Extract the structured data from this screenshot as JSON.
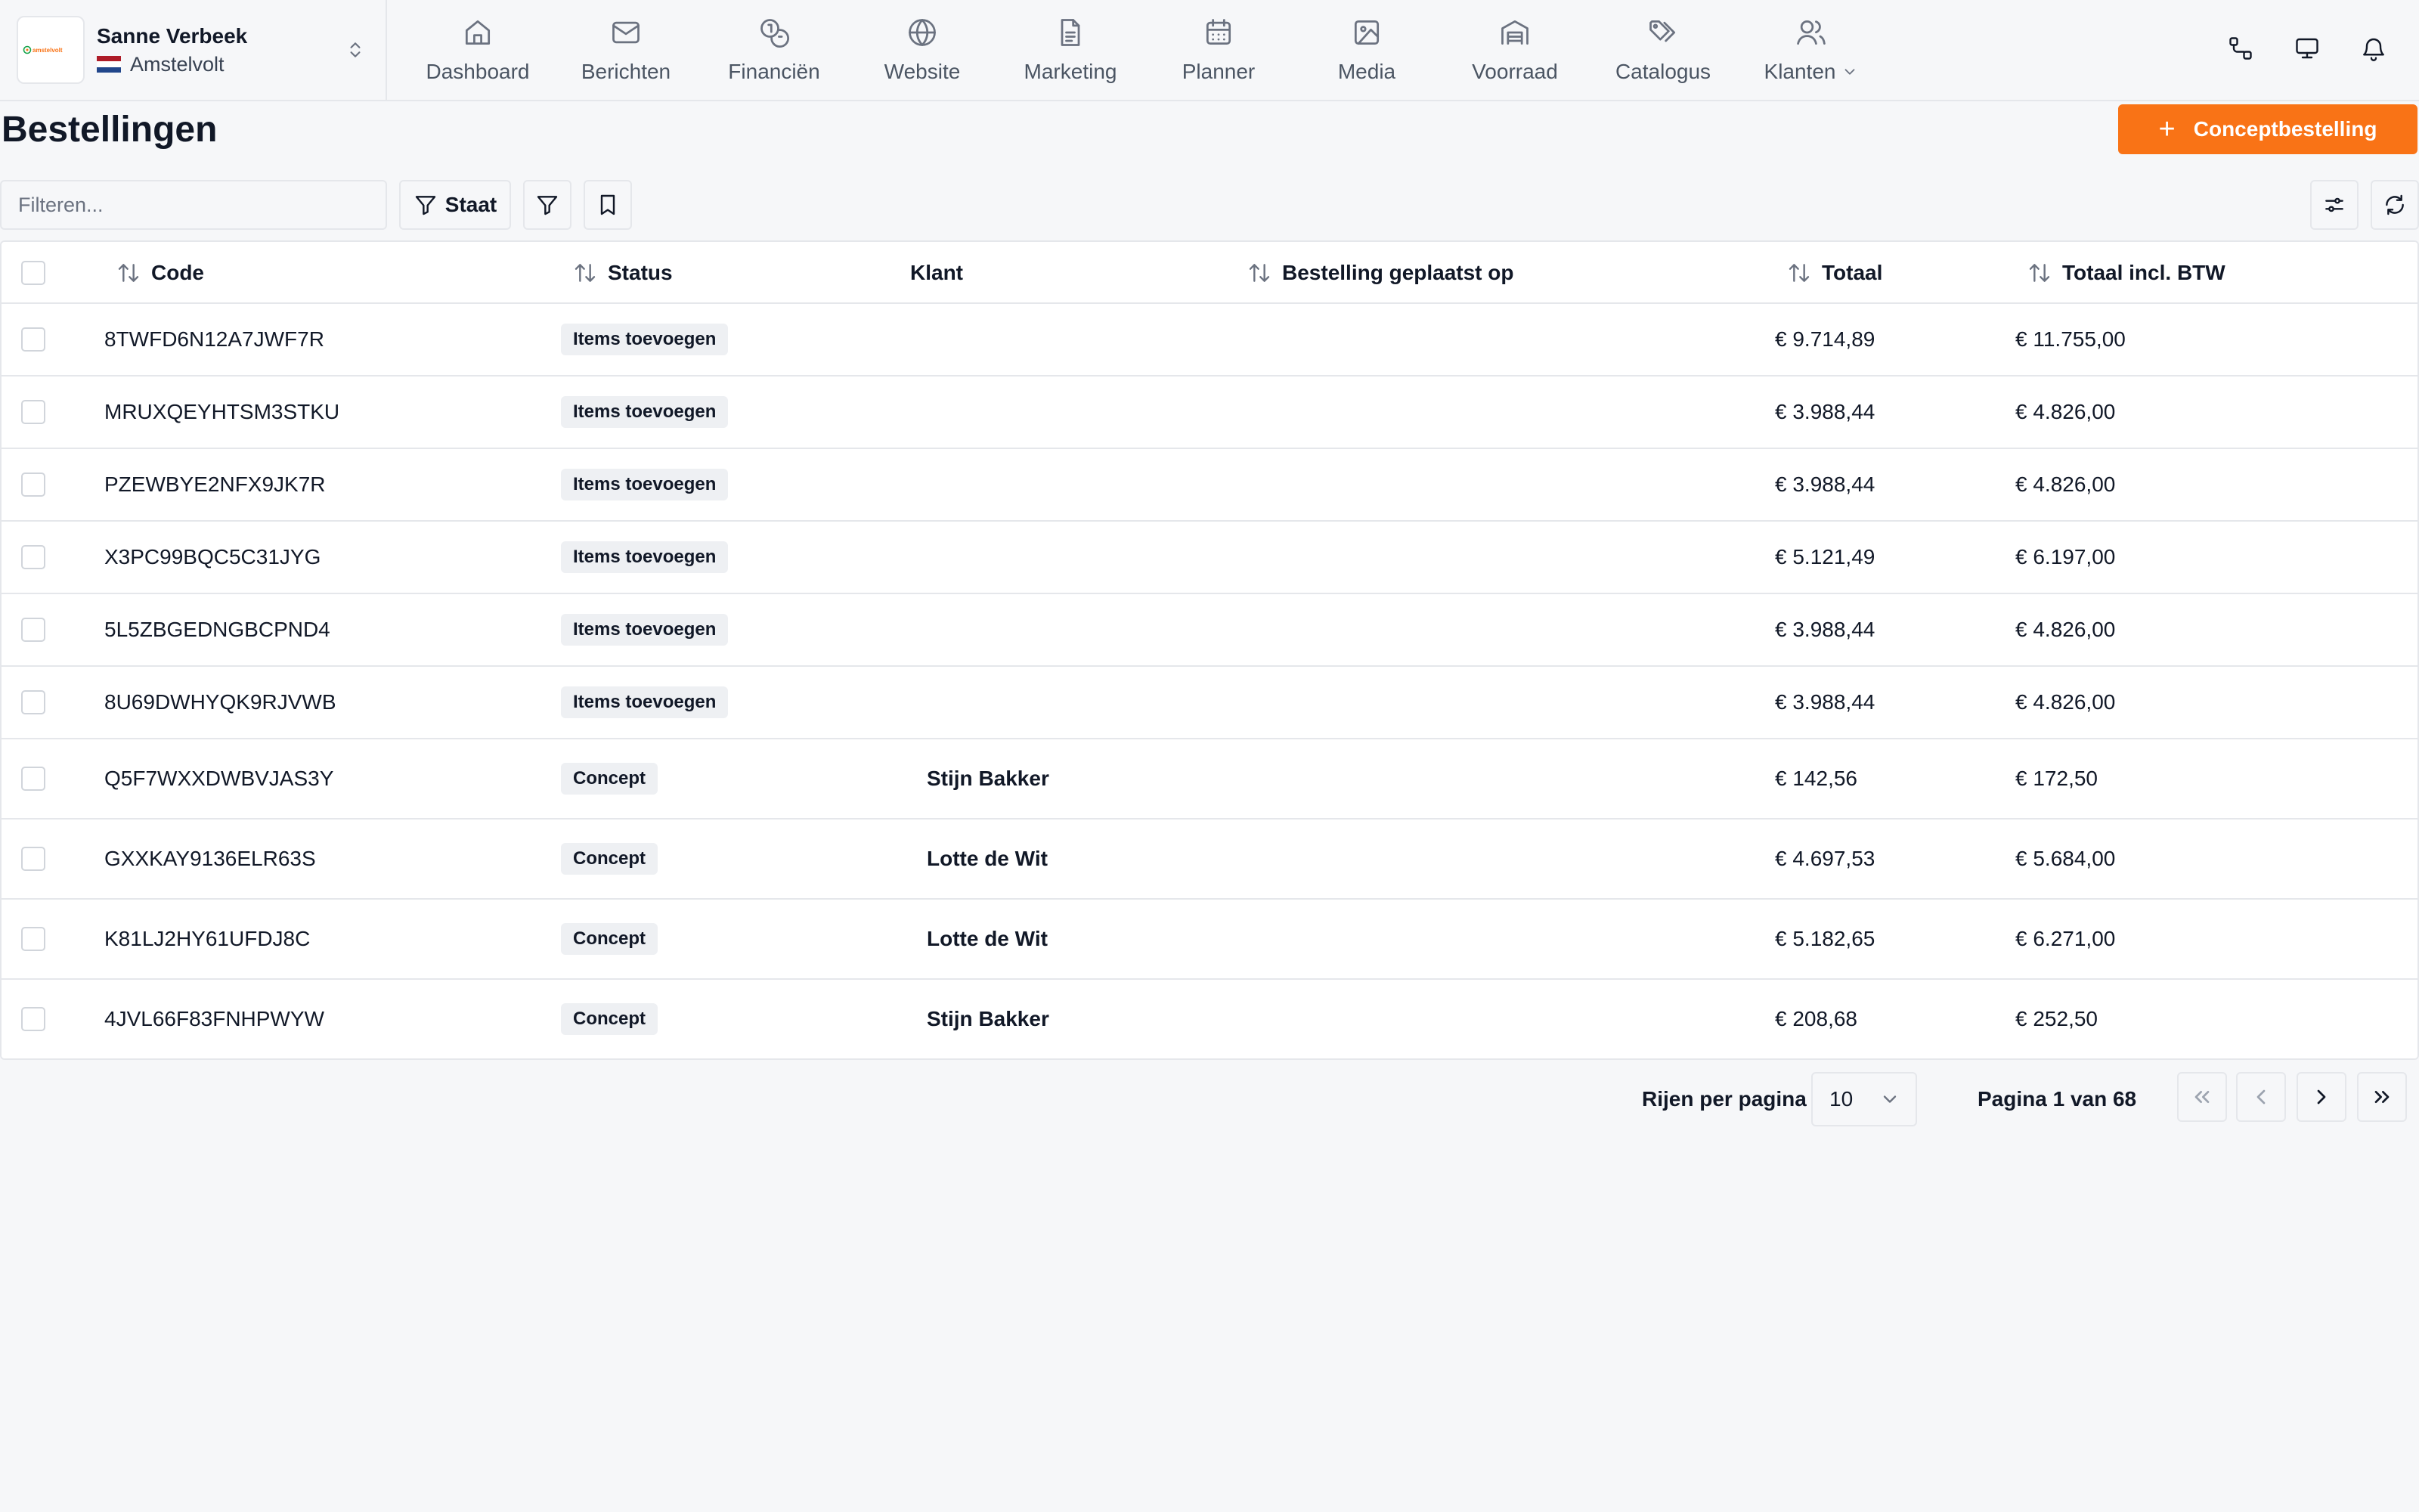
{
  "account": {
    "name": "Sanne Verbeek",
    "location": "Amstelvolt",
    "logo_text": "amstelvolt"
  },
  "nav": [
    {
      "label": "Dashboard",
      "icon": "home-icon"
    },
    {
      "label": "Berichten",
      "icon": "mail-icon"
    },
    {
      "label": "Financiën",
      "icon": "coins-icon"
    },
    {
      "label": "Website",
      "icon": "globe-icon"
    },
    {
      "label": "Marketing",
      "icon": "document-icon"
    },
    {
      "label": "Planner",
      "icon": "calendar-icon"
    },
    {
      "label": "Media",
      "icon": "image-icon"
    },
    {
      "label": "Voorraad",
      "icon": "warehouse-icon"
    },
    {
      "label": "Catalogus",
      "icon": "tags-icon"
    },
    {
      "label": "Klanten",
      "icon": "users-icon",
      "has_dropdown": true
    }
  ],
  "top_actions": [
    "workflow-icon",
    "monitor-icon",
    "bell-icon"
  ],
  "page": {
    "title": "Bestellingen",
    "primary_button": "Conceptbestelling"
  },
  "toolbar": {
    "filter_placeholder": "Filteren...",
    "state_button": "Staat"
  },
  "table": {
    "columns": [
      "Code",
      "Status",
      "Klant",
      "Bestelling geplaatst op",
      "Totaal",
      "Totaal incl. BTW"
    ],
    "rows": [
      {
        "code": "8TWFD6N12A7JWF7R",
        "status": "Items toevoegen",
        "customer": "",
        "placed_on": "",
        "total": "€ 9.714,89",
        "total_vat": "€ 11.755,00"
      },
      {
        "code": "MRUXQEYHTSM3STKU",
        "status": "Items toevoegen",
        "customer": "",
        "placed_on": "",
        "total": "€ 3.988,44",
        "total_vat": "€ 4.826,00"
      },
      {
        "code": "PZEWBYE2NFX9JK7R",
        "status": "Items toevoegen",
        "customer": "",
        "placed_on": "",
        "total": "€ 3.988,44",
        "total_vat": "€ 4.826,00"
      },
      {
        "code": "X3PC99BQC5C31JYG",
        "status": "Items toevoegen",
        "customer": "",
        "placed_on": "",
        "total": "€ 5.121,49",
        "total_vat": "€ 6.197,00"
      },
      {
        "code": "5L5ZBGEDNGBCPND4",
        "status": "Items toevoegen",
        "customer": "",
        "placed_on": "",
        "total": "€ 3.988,44",
        "total_vat": "€ 4.826,00"
      },
      {
        "code": "8U69DWHYQK9RJVWB",
        "status": "Items toevoegen",
        "customer": "",
        "placed_on": "",
        "total": "€ 3.988,44",
        "total_vat": "€ 4.826,00"
      },
      {
        "code": "Q5F7WXXDWBVJAS3Y",
        "status": "Concept",
        "customer": "Stijn Bakker",
        "placed_on": "",
        "total": "€ 142,56",
        "total_vat": "€ 172,50"
      },
      {
        "code": "GXXKAY9136ELR63S",
        "status": "Concept",
        "customer": "Lotte de Wit",
        "placed_on": "",
        "total": "€ 4.697,53",
        "total_vat": "€ 5.684,00"
      },
      {
        "code": "K81LJ2HY61UFDJ8C",
        "status": "Concept",
        "customer": "Lotte de Wit",
        "placed_on": "",
        "total": "€ 5.182,65",
        "total_vat": "€ 6.271,00"
      },
      {
        "code": "4JVL66F83FNHPWYW",
        "status": "Concept",
        "customer": "Stijn Bakker",
        "placed_on": "",
        "total": "€ 208,68",
        "total_vat": "€ 252,50"
      }
    ]
  },
  "pagination": {
    "rows_per_page_label": "Rijen per pagina",
    "rows_per_page": "10",
    "page_info": "Pagina 1 van 68"
  },
  "colors": {
    "accent": "#f97316",
    "border": "#e5e7eb",
    "background": "#f6f7f9"
  }
}
